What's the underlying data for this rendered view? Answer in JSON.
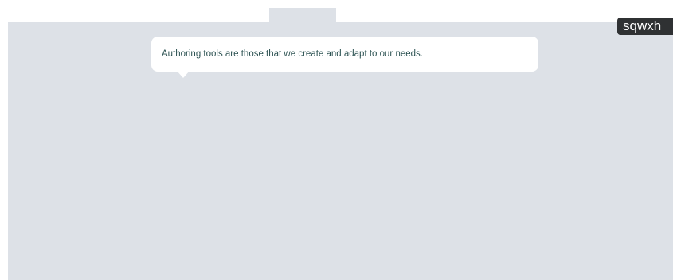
{
  "tooltip": {
    "text": "Authoring tools are those that we create and adapt to our needs."
  },
  "user_badge": {
    "label": "sqwxh"
  },
  "colors": {
    "canvas": "#dde1e7",
    "tooltip_bg": "#ffffff",
    "tooltip_text": "#2c5252",
    "badge_bg": "#2f3133"
  }
}
